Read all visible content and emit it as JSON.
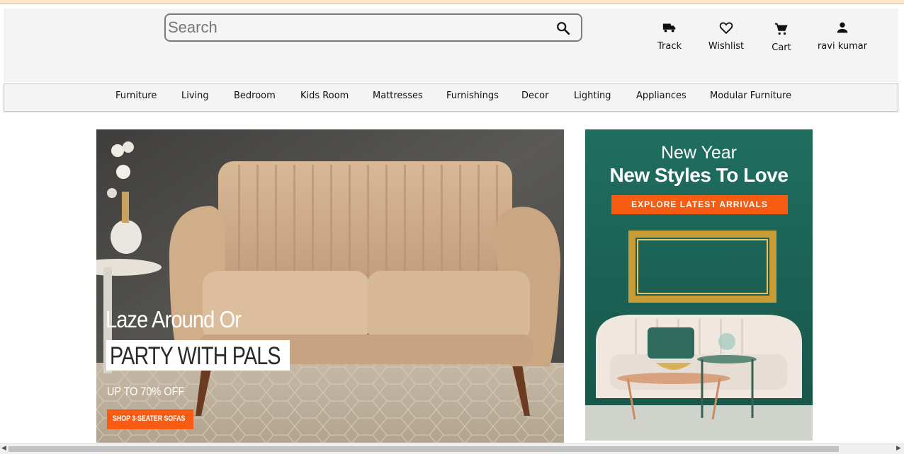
{
  "header": {
    "search_placeholder": "Search",
    "actions": {
      "track": "Track",
      "wishlist": "Wishlist",
      "cart": "Cart",
      "account": "ravi kumar"
    }
  },
  "nav": {
    "items": [
      "Furniture",
      "Living",
      "Bedroom",
      "Kids Room",
      "Mattresses",
      "Furnishings",
      "Decor",
      "Lighting",
      "Appliances",
      "Modular Furniture"
    ]
  },
  "banner_main": {
    "line1": "Laze Around Or",
    "line2": "PARTY WITH PALS",
    "offer": "UP TO 70% OFF",
    "cta": "SHOP 3-SEATER SOFAS"
  },
  "banner_side": {
    "line1": "New Year",
    "line2": "New Styles To Love",
    "cta": "EXPLORE LATEST ARRIVALS"
  },
  "colors": {
    "accent_orange": "#f85c12",
    "side_banner_bg": "#1e6b5c",
    "header_bg": "#f4f4f4"
  }
}
